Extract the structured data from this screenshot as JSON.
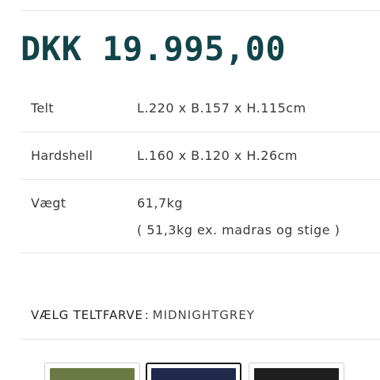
{
  "price": "DKK 19.995,00",
  "specs": [
    {
      "label": "Telt",
      "value": "L.220 x B.157 x H.115cm"
    },
    {
      "label": "Hardshell",
      "value": "L.160 x B.120 x H.26cm"
    },
    {
      "label": "Vægt",
      "value": "61,7kg",
      "note": "( 51,3kg ex. madras og stige )"
    }
  ],
  "color_picker": {
    "label": "VÆLG TELTFARVE",
    "separator": ":",
    "selected": "MIDNIGHTGREY",
    "swatches": [
      {
        "name": "green",
        "color": "#6b7a45",
        "selected": false
      },
      {
        "name": "midnightgrey",
        "color": "#1f2a4a",
        "selected": true
      },
      {
        "name": "black",
        "color": "#1e1e1e",
        "selected": false
      }
    ]
  }
}
